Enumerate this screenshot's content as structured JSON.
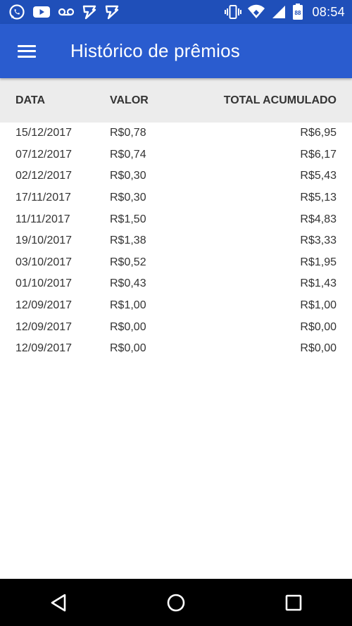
{
  "status_bar": {
    "time": "08:54",
    "battery_level": "88",
    "left_icons": [
      "whatsapp-icon",
      "youtube-icon",
      "voicemail-icon",
      "app-notification-icon",
      "app-notification-icon"
    ],
    "right_icons": [
      "vibrate-icon",
      "wifi-icon",
      "signal-icon",
      "battery-icon"
    ]
  },
  "app_bar": {
    "title": "Histórico de prêmios",
    "menu_icon": "hamburger-menu-icon"
  },
  "table": {
    "headers": {
      "date": "DATA",
      "value": "VALOR",
      "total": "TOTAL ACUMULADO"
    },
    "rows": [
      {
        "date": "15/12/2017",
        "value": "R$0,78",
        "total": "R$6,95"
      },
      {
        "date": "07/12/2017",
        "value": "R$0,74",
        "total": "R$6,17"
      },
      {
        "date": "02/12/2017",
        "value": "R$0,30",
        "total": "R$5,43"
      },
      {
        "date": "17/11/2017",
        "value": "R$0,30",
        "total": "R$5,13"
      },
      {
        "date": "11/11/2017",
        "value": "R$1,50",
        "total": "R$4,83"
      },
      {
        "date": "19/10/2017",
        "value": "R$1,38",
        "total": "R$3,33"
      },
      {
        "date": "03/10/2017",
        "value": "R$0,52",
        "total": "R$1,95"
      },
      {
        "date": "01/10/2017",
        "value": "R$0,43",
        "total": "R$1,43"
      },
      {
        "date": "12/09/2017",
        "value": "R$1,00",
        "total": "R$1,00"
      },
      {
        "date": "12/09/2017",
        "value": "R$0,00",
        "total": "R$0,00"
      },
      {
        "date": "12/09/2017",
        "value": "R$0,00",
        "total": "R$0,00"
      }
    ]
  },
  "nav_bar": {
    "buttons": [
      "back-icon",
      "home-icon",
      "recents-icon"
    ]
  },
  "colors": {
    "status_bar": "#1f4fb9",
    "app_bar": "#2a5ccf",
    "header_bg": "#ececec",
    "text": "#333333",
    "nav_bar": "#000000"
  }
}
